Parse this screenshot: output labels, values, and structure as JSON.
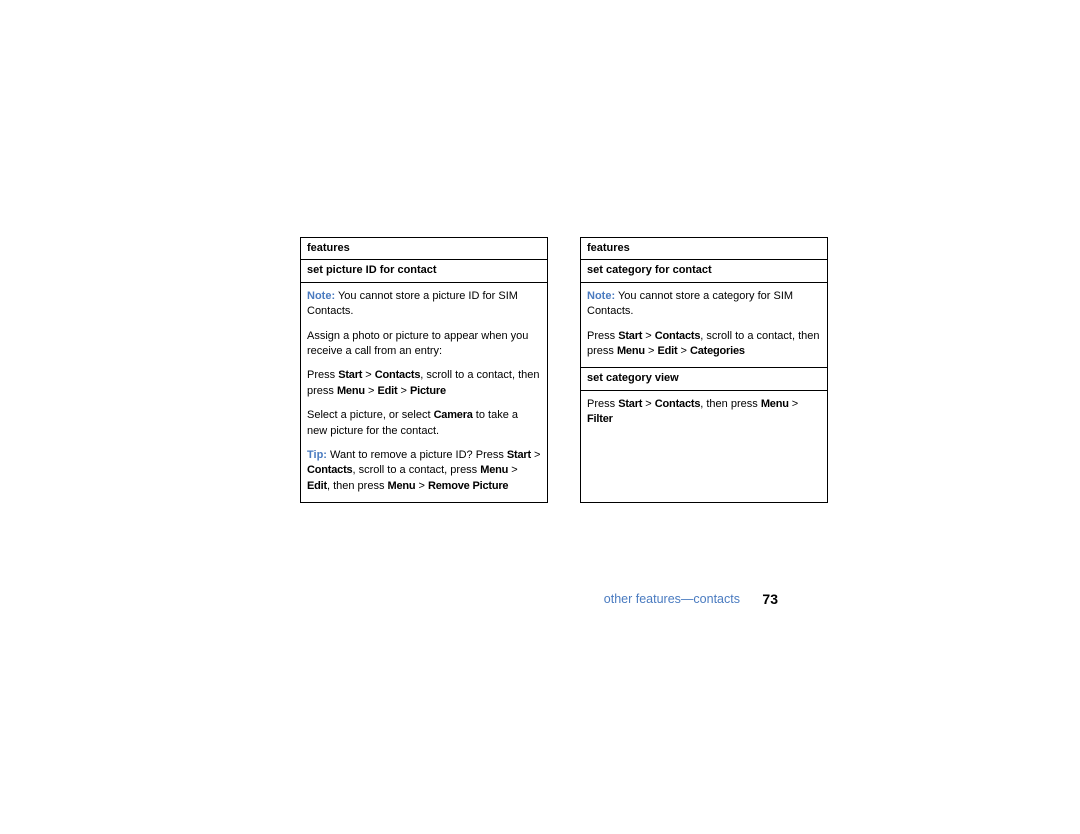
{
  "left": {
    "header": "features",
    "subheader": "set picture ID for contact",
    "note_label": "Note:",
    "note_text": " You cannot store a picture ID for SIM Contacts.",
    "p2": "Assign a photo or picture to appear when you receive a call from an entry:",
    "p3_a": "Press ",
    "p3_start": "Start",
    "p3_gt1": " > ",
    "p3_contacts": "Contacts",
    "p3_b": ", scroll to a contact, then press ",
    "p3_menu": "Menu",
    "p3_gt2": " > ",
    "p3_edit": "Edit",
    "p3_gt3": " > ",
    "p3_picture": "Picture",
    "p4_a": "Select a picture, or select ",
    "p4_camera": "Camera",
    "p4_b": " to take a new picture for the contact.",
    "tip_label": "Tip:",
    "p5_a": " Want to remove a picture ID? Press ",
    "p5_start": "Start",
    "p5_gt1": " > ",
    "p5_contacts": "Contacts",
    "p5_b": ", scroll to a contact, press ",
    "p5_menu": "Menu",
    "p5_gt2": " > ",
    "p5_edit": "Edit",
    "p5_c": ", then press ",
    "p5_menu2": "Menu",
    "p5_gt3": " > ",
    "p5_remove": "Remove Picture"
  },
  "right": {
    "header": "features",
    "sub1": "set category for contact",
    "note_label": "Note:",
    "note_text": " You cannot store a category for SIM Contacts.",
    "p2_a": "Press ",
    "p2_start": "Start",
    "p2_gt1": " > ",
    "p2_contacts": "Contacts",
    "p2_b": ", scroll to a contact, then press ",
    "p2_menu": "Menu",
    "p2_gt2": " > ",
    "p2_edit": "Edit",
    "p2_gt3": " > ",
    "p2_categories": "Categories",
    "sub2": "set category view",
    "p3_a": "Press ",
    "p3_start": "Start",
    "p3_gt1": " > ",
    "p3_contacts": "Contacts",
    "p3_b": ", then press ",
    "p3_menu": "Menu",
    "p3_gt2": " > ",
    "p3_filter": "Filter"
  },
  "footer": {
    "label": "other features—contacts",
    "page": "73"
  }
}
